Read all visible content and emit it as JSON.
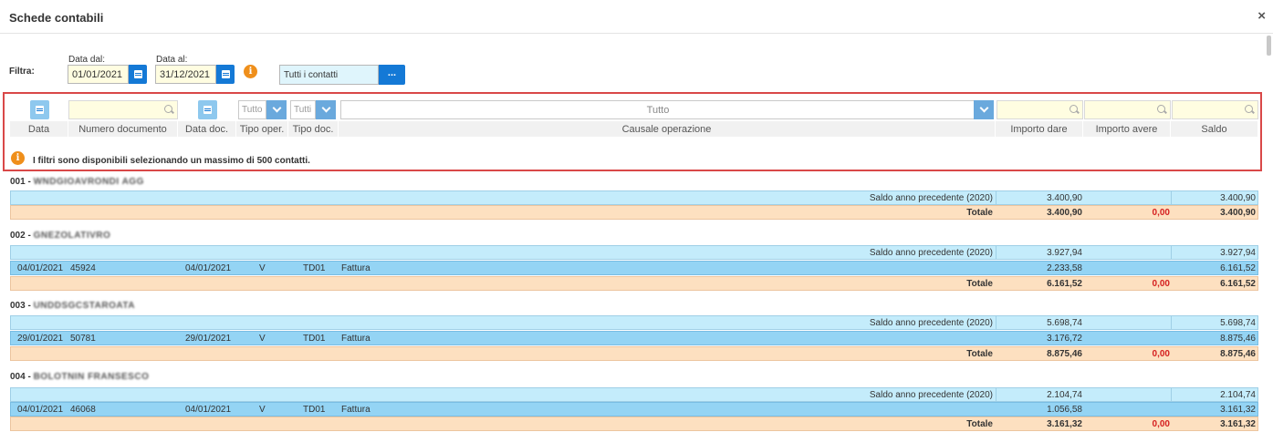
{
  "window": {
    "title": "Schede contabili",
    "close": "×"
  },
  "filters": {
    "label": "Filtra:",
    "date_from_label": "Data dal:",
    "date_from": "01/01/2021",
    "date_to_label": "Data al:",
    "date_to": "31/12/2021",
    "contacts": "Tutti i contatti",
    "contacts_button": "..."
  },
  "grid_filters": {
    "tipo_oper": "Tutto",
    "tipo_doc": "Tutti",
    "causale": "Tutto"
  },
  "columns": [
    "Data",
    "Numero documento",
    "Data doc.",
    "Tipo oper.",
    "Tipo doc.",
    "Causale operazione",
    "Importo dare",
    "Importo avere",
    "Saldo"
  ],
  "notice": "I filtri sono disponibili selezionando un massimo di 500 contatti.",
  "groups": [
    {
      "code": "001 -",
      "name": "WNDGIOAVRONDI AGG",
      "prev": {
        "label": "Saldo anno precedente (2020)",
        "dare": "3.400,90",
        "saldo": "3.400,90"
      },
      "docs": [],
      "total": {
        "label": "Totale",
        "dare": "3.400,90",
        "avere": "0,00",
        "saldo": "3.400,90"
      }
    },
    {
      "code": "002 -",
      "name": "GNEZOLATIVRO",
      "prev": {
        "label": "Saldo anno precedente (2020)",
        "dare": "3.927,94",
        "saldo": "3.927,94"
      },
      "docs": [
        {
          "data": "04/01/2021",
          "num": "45924",
          "data_doc": "04/01/2021",
          "tipo_oper": "V",
          "tipo_doc": "TD01",
          "causale": "Fattura",
          "dare": "2.233,58",
          "saldo": "6.161,52"
        }
      ],
      "total": {
        "label": "Totale",
        "dare": "6.161,52",
        "avere": "0,00",
        "saldo": "6.161,52"
      }
    },
    {
      "code": "003 -",
      "name": "UNDDSGCSTAROATA",
      "prev": {
        "label": "Saldo anno precedente (2020)",
        "dare": "5.698,74",
        "saldo": "5.698,74"
      },
      "docs": [
        {
          "data": "29/01/2021",
          "num": "50781",
          "data_doc": "29/01/2021",
          "tipo_oper": "V",
          "tipo_doc": "TD01",
          "causale": "Fattura",
          "dare": "3.176,72",
          "saldo": "8.875,46"
        }
      ],
      "total": {
        "label": "Totale",
        "dare": "8.875,46",
        "avere": "0,00",
        "saldo": "8.875,46"
      }
    },
    {
      "code": "004 -",
      "name": "BOLOTNIN FRANSESCO",
      "prev": {
        "label": "Saldo anno precedente (2020)",
        "dare": "2.104,74",
        "saldo": "2.104,74"
      },
      "docs": [
        {
          "data": "04/01/2021",
          "num": "46068",
          "data_doc": "04/01/2021",
          "tipo_oper": "V",
          "tipo_doc": "TD01",
          "causale": "Fattura",
          "dare": "1.056,58",
          "saldo": "3.161,32"
        }
      ],
      "total": {
        "label": "Totale",
        "dare": "3.161,32",
        "avere": "0,00",
        "saldo": "3.161,32"
      }
    }
  ],
  "colors": {
    "accent": "#1479d6",
    "highlight_border": "#d94848",
    "warning": "#ef8f1b"
  }
}
